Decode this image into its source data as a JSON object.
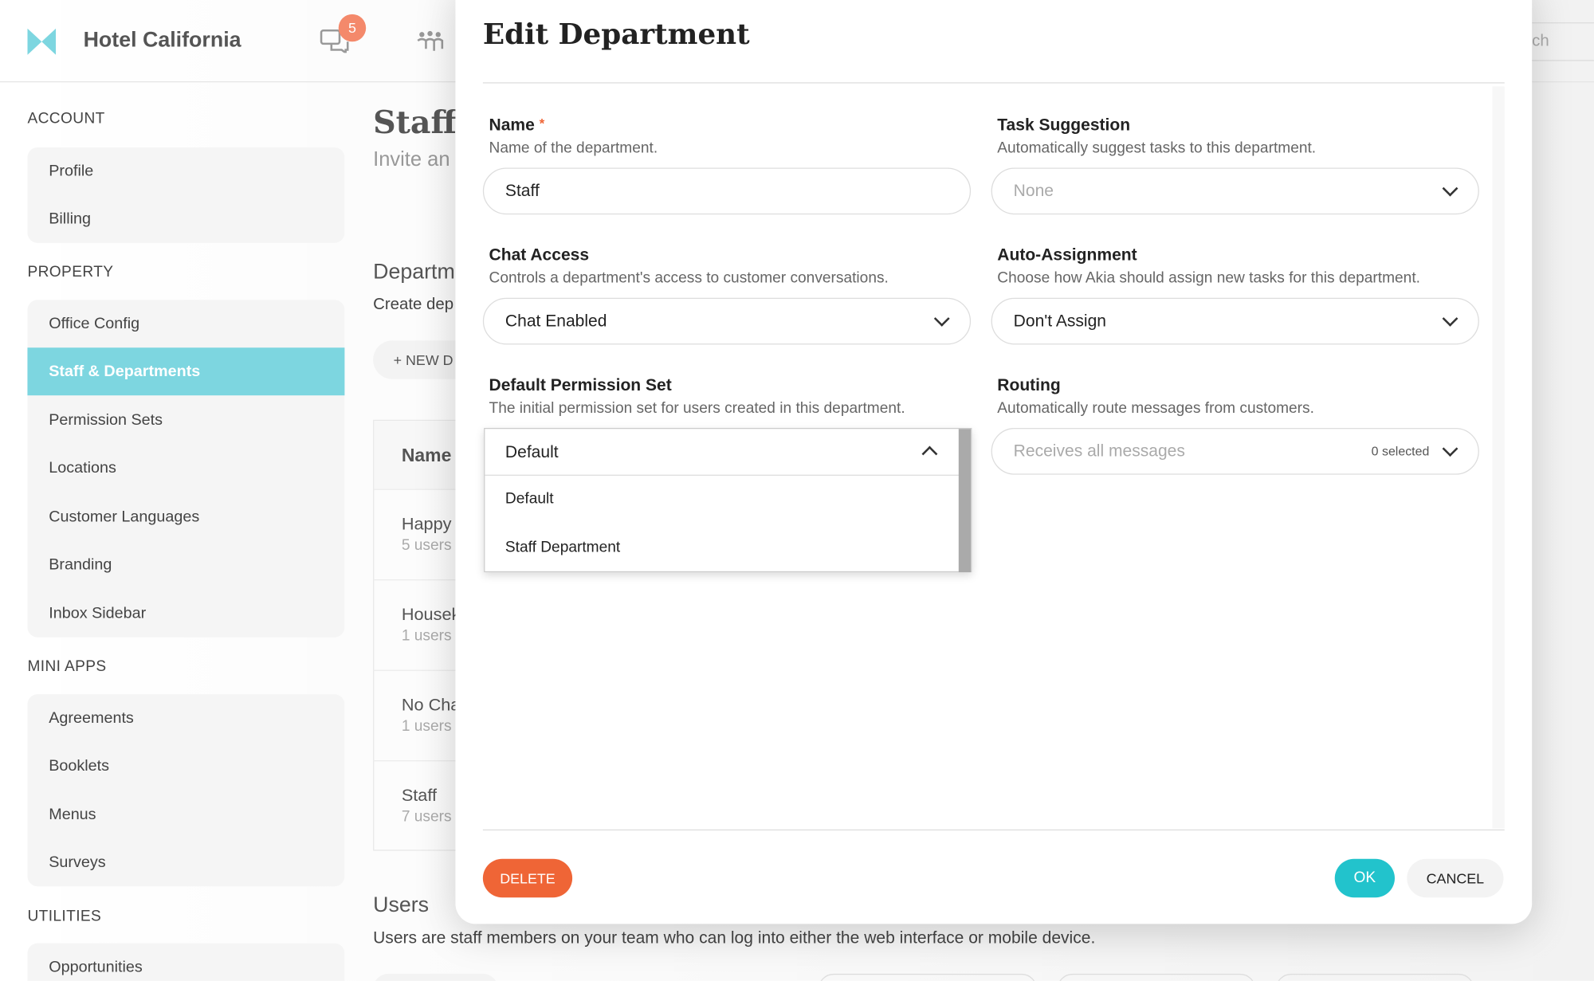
{
  "header": {
    "brand": "Hotel California",
    "chat_badge": "5",
    "search_partial": "ch",
    "accent": "#7dd6e0"
  },
  "sidebar": {
    "sections": [
      {
        "title": "ACCOUNT",
        "items": [
          "Profile",
          "Billing"
        ]
      },
      {
        "title": "PROPERTY",
        "items": [
          "Office Config",
          "Staff & Departments",
          "Permission Sets",
          "Locations",
          "Customer Languages",
          "Branding",
          "Inbox Sidebar"
        ]
      },
      {
        "title": "MINI APPS",
        "items": [
          "Agreements",
          "Booklets",
          "Menus",
          "Surveys"
        ]
      },
      {
        "title": "UTILITIES",
        "items": [
          "Opportunities"
        ]
      }
    ],
    "active": "Staff & Departments"
  },
  "main": {
    "title": "Staff",
    "subtitle": "Invite an",
    "dept_heading": "Departm",
    "dept_desc": "Create dep",
    "new_button": "+ NEW D",
    "table_header": "Name",
    "rows": [
      {
        "name": "Happy",
        "users": "5 users"
      },
      {
        "name": "Housek",
        "users": "1 users"
      },
      {
        "name": "No Cha",
        "users": "1 users"
      },
      {
        "name": "Staff",
        "users": "7 users"
      }
    ],
    "users_heading": "Users",
    "users_desc": "Users are staff members on your team who can log into either the web interface or mobile device."
  },
  "modal": {
    "title": "Edit Department",
    "name": {
      "label": "Name",
      "required": "*",
      "desc": "Name of the department.",
      "value": "Staff"
    },
    "task_suggestion": {
      "label": "Task Suggestion",
      "desc": "Automatically suggest tasks to this department.",
      "placeholder": "None"
    },
    "chat_access": {
      "label": "Chat Access",
      "desc": "Controls a department's access to customer conversations.",
      "value": "Chat Enabled"
    },
    "auto_assignment": {
      "label": "Auto-Assignment",
      "desc": "Choose how Akia should assign new tasks for this department.",
      "value": "Don't Assign"
    },
    "permission_set": {
      "label": "Default Permission Set",
      "desc": "The initial permission set for users created in this department.",
      "value": "Default",
      "options": [
        "Default",
        "Staff Department"
      ]
    },
    "routing": {
      "label": "Routing",
      "desc": "Automatically route messages from customers.",
      "placeholder": "Receives all messages",
      "count": "0 selected"
    },
    "delete_label": "DELETE",
    "ok_label": "OK",
    "cancel_label": "CANCEL",
    "colors": {
      "delete": "#ef6536",
      "ok": "#22c3cc"
    }
  }
}
